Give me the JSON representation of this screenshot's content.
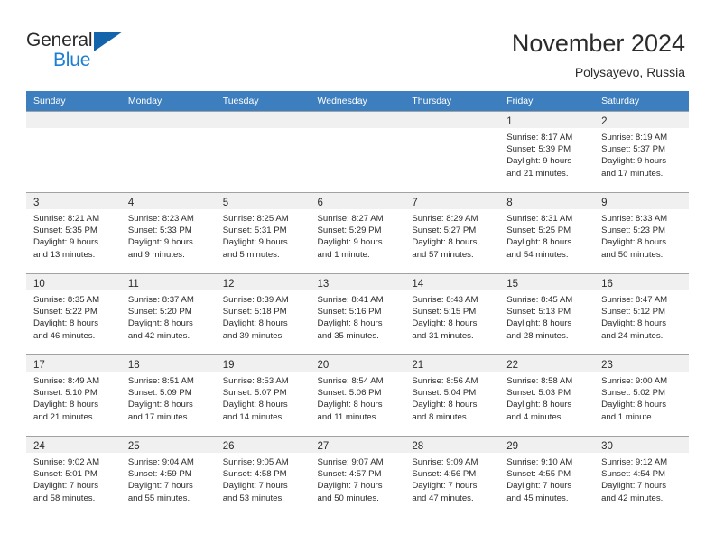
{
  "brand": {
    "name_line1": "General",
    "name_line2": "Blue",
    "triangle_color": "#1464ac",
    "blue_color": "#1b7fd4"
  },
  "header": {
    "title": "November 2024",
    "subtitle": "Polysayevo, Russia",
    "header_bg": "#3d7ebf",
    "daynum_bg": "#f0f0f0"
  },
  "weekday_headers": [
    "Sunday",
    "Monday",
    "Tuesday",
    "Wednesday",
    "Thursday",
    "Friday",
    "Saturday"
  ],
  "weeks": [
    [
      {
        "day": "",
        "empty": true
      },
      {
        "day": "",
        "empty": true
      },
      {
        "day": "",
        "empty": true
      },
      {
        "day": "",
        "empty": true
      },
      {
        "day": "",
        "empty": true
      },
      {
        "day": "1",
        "sunrise": "Sunrise: 8:17 AM",
        "sunset": "Sunset: 5:39 PM",
        "daylight1": "Daylight: 9 hours",
        "daylight2": "and 21 minutes."
      },
      {
        "day": "2",
        "sunrise": "Sunrise: 8:19 AM",
        "sunset": "Sunset: 5:37 PM",
        "daylight1": "Daylight: 9 hours",
        "daylight2": "and 17 minutes."
      }
    ],
    [
      {
        "day": "3",
        "sunrise": "Sunrise: 8:21 AM",
        "sunset": "Sunset: 5:35 PM",
        "daylight1": "Daylight: 9 hours",
        "daylight2": "and 13 minutes."
      },
      {
        "day": "4",
        "sunrise": "Sunrise: 8:23 AM",
        "sunset": "Sunset: 5:33 PM",
        "daylight1": "Daylight: 9 hours",
        "daylight2": "and 9 minutes."
      },
      {
        "day": "5",
        "sunrise": "Sunrise: 8:25 AM",
        "sunset": "Sunset: 5:31 PM",
        "daylight1": "Daylight: 9 hours",
        "daylight2": "and 5 minutes."
      },
      {
        "day": "6",
        "sunrise": "Sunrise: 8:27 AM",
        "sunset": "Sunset: 5:29 PM",
        "daylight1": "Daylight: 9 hours",
        "daylight2": "and 1 minute."
      },
      {
        "day": "7",
        "sunrise": "Sunrise: 8:29 AM",
        "sunset": "Sunset: 5:27 PM",
        "daylight1": "Daylight: 8 hours",
        "daylight2": "and 57 minutes."
      },
      {
        "day": "8",
        "sunrise": "Sunrise: 8:31 AM",
        "sunset": "Sunset: 5:25 PM",
        "daylight1": "Daylight: 8 hours",
        "daylight2": "and 54 minutes."
      },
      {
        "day": "9",
        "sunrise": "Sunrise: 8:33 AM",
        "sunset": "Sunset: 5:23 PM",
        "daylight1": "Daylight: 8 hours",
        "daylight2": "and 50 minutes."
      }
    ],
    [
      {
        "day": "10",
        "sunrise": "Sunrise: 8:35 AM",
        "sunset": "Sunset: 5:22 PM",
        "daylight1": "Daylight: 8 hours",
        "daylight2": "and 46 minutes."
      },
      {
        "day": "11",
        "sunrise": "Sunrise: 8:37 AM",
        "sunset": "Sunset: 5:20 PM",
        "daylight1": "Daylight: 8 hours",
        "daylight2": "and 42 minutes."
      },
      {
        "day": "12",
        "sunrise": "Sunrise: 8:39 AM",
        "sunset": "Sunset: 5:18 PM",
        "daylight1": "Daylight: 8 hours",
        "daylight2": "and 39 minutes."
      },
      {
        "day": "13",
        "sunrise": "Sunrise: 8:41 AM",
        "sunset": "Sunset: 5:16 PM",
        "daylight1": "Daylight: 8 hours",
        "daylight2": "and 35 minutes."
      },
      {
        "day": "14",
        "sunrise": "Sunrise: 8:43 AM",
        "sunset": "Sunset: 5:15 PM",
        "daylight1": "Daylight: 8 hours",
        "daylight2": "and 31 minutes."
      },
      {
        "day": "15",
        "sunrise": "Sunrise: 8:45 AM",
        "sunset": "Sunset: 5:13 PM",
        "daylight1": "Daylight: 8 hours",
        "daylight2": "and 28 minutes."
      },
      {
        "day": "16",
        "sunrise": "Sunrise: 8:47 AM",
        "sunset": "Sunset: 5:12 PM",
        "daylight1": "Daylight: 8 hours",
        "daylight2": "and 24 minutes."
      }
    ],
    [
      {
        "day": "17",
        "sunrise": "Sunrise: 8:49 AM",
        "sunset": "Sunset: 5:10 PM",
        "daylight1": "Daylight: 8 hours",
        "daylight2": "and 21 minutes."
      },
      {
        "day": "18",
        "sunrise": "Sunrise: 8:51 AM",
        "sunset": "Sunset: 5:09 PM",
        "daylight1": "Daylight: 8 hours",
        "daylight2": "and 17 minutes."
      },
      {
        "day": "19",
        "sunrise": "Sunrise: 8:53 AM",
        "sunset": "Sunset: 5:07 PM",
        "daylight1": "Daylight: 8 hours",
        "daylight2": "and 14 minutes."
      },
      {
        "day": "20",
        "sunrise": "Sunrise: 8:54 AM",
        "sunset": "Sunset: 5:06 PM",
        "daylight1": "Daylight: 8 hours",
        "daylight2": "and 11 minutes."
      },
      {
        "day": "21",
        "sunrise": "Sunrise: 8:56 AM",
        "sunset": "Sunset: 5:04 PM",
        "daylight1": "Daylight: 8 hours",
        "daylight2": "and 8 minutes."
      },
      {
        "day": "22",
        "sunrise": "Sunrise: 8:58 AM",
        "sunset": "Sunset: 5:03 PM",
        "daylight1": "Daylight: 8 hours",
        "daylight2": "and 4 minutes."
      },
      {
        "day": "23",
        "sunrise": "Sunrise: 9:00 AM",
        "sunset": "Sunset: 5:02 PM",
        "daylight1": "Daylight: 8 hours",
        "daylight2": "and 1 minute."
      }
    ],
    [
      {
        "day": "24",
        "sunrise": "Sunrise: 9:02 AM",
        "sunset": "Sunset: 5:01 PM",
        "daylight1": "Daylight: 7 hours",
        "daylight2": "and 58 minutes."
      },
      {
        "day": "25",
        "sunrise": "Sunrise: 9:04 AM",
        "sunset": "Sunset: 4:59 PM",
        "daylight1": "Daylight: 7 hours",
        "daylight2": "and 55 minutes."
      },
      {
        "day": "26",
        "sunrise": "Sunrise: 9:05 AM",
        "sunset": "Sunset: 4:58 PM",
        "daylight1": "Daylight: 7 hours",
        "daylight2": "and 53 minutes."
      },
      {
        "day": "27",
        "sunrise": "Sunrise: 9:07 AM",
        "sunset": "Sunset: 4:57 PM",
        "daylight1": "Daylight: 7 hours",
        "daylight2": "and 50 minutes."
      },
      {
        "day": "28",
        "sunrise": "Sunrise: 9:09 AM",
        "sunset": "Sunset: 4:56 PM",
        "daylight1": "Daylight: 7 hours",
        "daylight2": "and 47 minutes."
      },
      {
        "day": "29",
        "sunrise": "Sunrise: 9:10 AM",
        "sunset": "Sunset: 4:55 PM",
        "daylight1": "Daylight: 7 hours",
        "daylight2": "and 45 minutes."
      },
      {
        "day": "30",
        "sunrise": "Sunrise: 9:12 AM",
        "sunset": "Sunset: 4:54 PM",
        "daylight1": "Daylight: 7 hours",
        "daylight2": "and 42 minutes."
      }
    ]
  ]
}
